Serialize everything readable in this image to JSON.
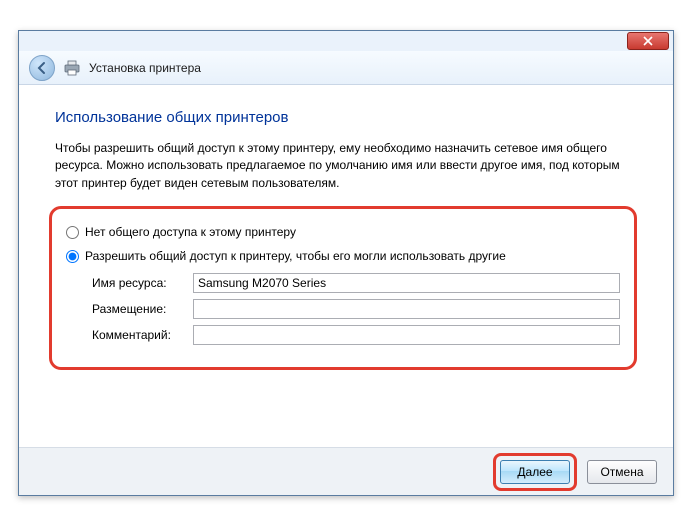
{
  "window": {
    "title": "Установка принтера"
  },
  "page": {
    "heading": "Использование общих принтеров",
    "description": "Чтобы разрешить общий доступ к этому принтеру, ему необходимо назначить сетевое имя общего ресурса. Можно использовать предлагаемое по умолчанию имя или ввести другое имя, под которым этот принтер будет виден сетевым пользователям."
  },
  "sharing": {
    "option_no_share": "Нет общего доступа к этому принтеру",
    "option_share": "Разрешить общий доступ к принтеру, чтобы его могли использовать другие",
    "selected": "share",
    "fields": {
      "share_name": {
        "label": "Имя ресурса:",
        "value": "Samsung M2070 Series"
      },
      "location": {
        "label": "Размещение:",
        "value": ""
      },
      "comment": {
        "label": "Комментарий:",
        "value": ""
      }
    }
  },
  "buttons": {
    "next": "Далее",
    "cancel": "Отмена"
  }
}
